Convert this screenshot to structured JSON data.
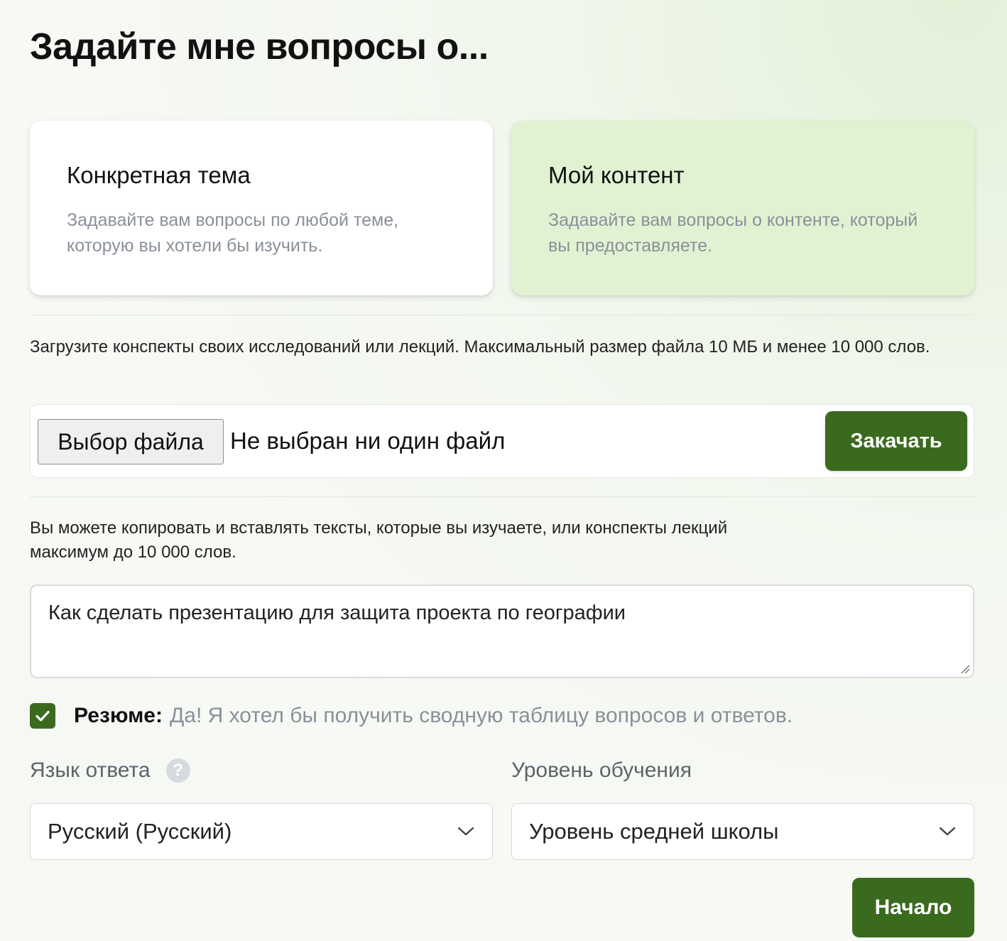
{
  "header": {
    "title": "Задайте мне вопросы о..."
  },
  "modes": [
    {
      "title": "Конкретная тема",
      "description": "Задавайте вам вопросы по любой теме, которую вы хотели бы изучить.",
      "selected": false
    },
    {
      "title": "Мой контент",
      "description": "Задавайте вам вопросы о контенте, который вы предоставляете.",
      "selected": true
    }
  ],
  "upload": {
    "hint": "Загрузите конспекты своих исследований или лекций. Максимальный размер файла 10 МБ и менее 10 000 слов.",
    "choose_label": "Выбор файла",
    "status": "Не выбран ни один файл",
    "button_label": "Закачать"
  },
  "paste": {
    "hint": "Вы можете копировать и вставлять тексты, которые вы изучаете, или конспекты лекций максимум до 10 000 слов.",
    "value": "Как сделать презентацию для защита проекта по географии"
  },
  "summary": {
    "checked": true,
    "label": "Резюме:",
    "text": "Да! Я хотел бы получить сводную таблицу вопросов и ответов."
  },
  "language": {
    "label": "Язык ответа",
    "help_symbol": "?",
    "selected": "Русский (Русский)"
  },
  "level": {
    "label": "Уровень обучения",
    "selected": "Уровень средней школы"
  },
  "start_button": "Начало",
  "colors": {
    "accent": "#3a6a1e",
    "selected_card": "#e1f2d3",
    "muted_text": "#8a9099"
  },
  "icons": {
    "checkbox": "check-icon",
    "help": "question-circle-icon",
    "dropdown": "chevron-down-icon",
    "resize": "resize-handle-icon"
  }
}
